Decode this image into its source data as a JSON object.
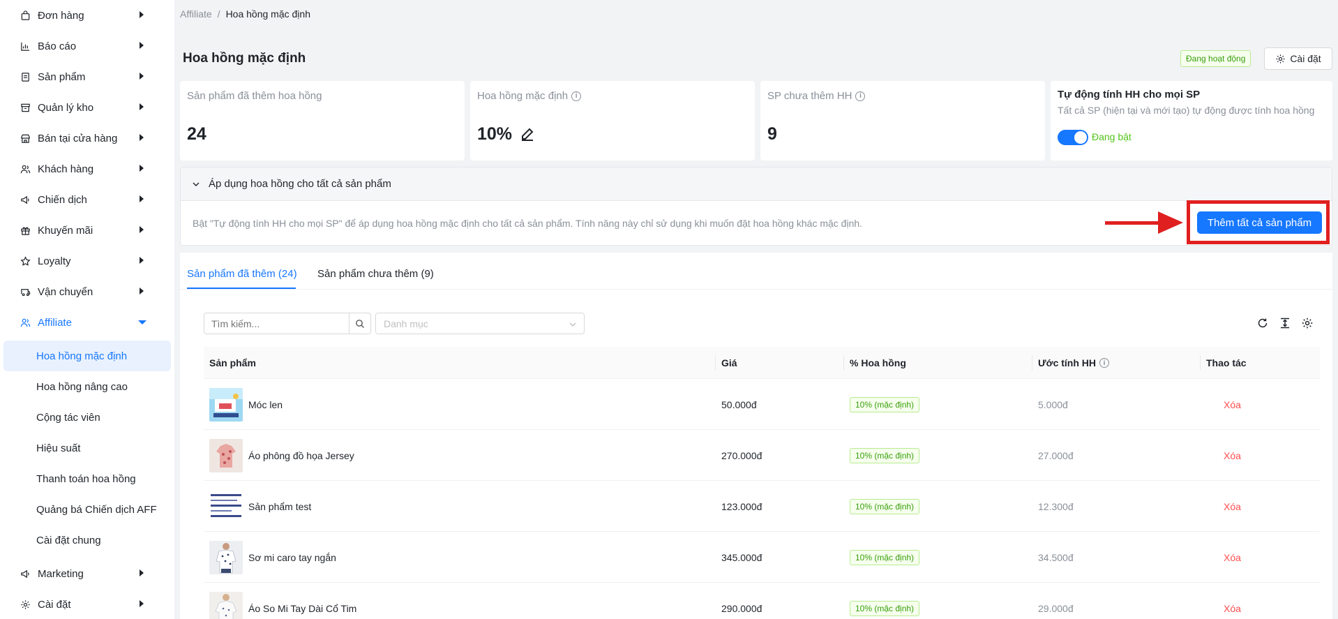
{
  "sidebar": {
    "items": [
      {
        "label": "Đơn hàng",
        "icon": "bag-icon"
      },
      {
        "label": "Báo cáo",
        "icon": "chart-icon"
      },
      {
        "label": "Sản phẩm",
        "icon": "document-icon"
      },
      {
        "label": "Quản lý kho",
        "icon": "archive-icon"
      },
      {
        "label": "Bán tại cửa hàng",
        "icon": "shop-icon"
      },
      {
        "label": "Khách hàng",
        "icon": "users-icon"
      },
      {
        "label": "Chiến dịch",
        "icon": "megaphone-icon"
      },
      {
        "label": "Khuyến mãi",
        "icon": "gift-icon"
      },
      {
        "label": "Loyalty",
        "icon": "star-icon"
      },
      {
        "label": "Vận chuyển",
        "icon": "truck-icon"
      },
      {
        "label": "Affiliate",
        "icon": "affiliate-icon"
      },
      {
        "label": "Marketing",
        "icon": "megaphone-icon"
      },
      {
        "label": "Cài đặt",
        "icon": "gear-icon"
      }
    ],
    "affiliate_sub": [
      "Hoa hồng mặc định",
      "Hoa hồng nâng cao",
      "Cộng tác viên",
      "Hiệu suất",
      "Thanh toán hoa hồng",
      "Quảng bá Chiến dịch AFF",
      "Cài đặt chung"
    ]
  },
  "breadcrumb": {
    "root": "Affiliate",
    "sep": "/",
    "current": "Hoa hồng mặc định"
  },
  "header": {
    "title": "Hoa hồng mặc định",
    "status": "Đang hoạt động",
    "settings_label": "Cài đặt"
  },
  "stats": {
    "added": {
      "label": "Sản phẩm đã thêm hoa hồng",
      "value": "24"
    },
    "default_rate": {
      "label": "Hoa hồng mặc định",
      "value": "10%"
    },
    "not_added": {
      "label": "SP chưa thêm HH",
      "value": "9"
    },
    "auto": {
      "title": "Tự động tính HH cho mọi SP",
      "desc": "Tất cả SP (hiện tại và mới tạo) tự động được tính hoa hồng",
      "toggle_label": "Đang bật",
      "enabled": true
    }
  },
  "apply_panel": {
    "title": "Áp dụng hoa hồng cho tất cả sản phẩm",
    "description": "Bật \"Tự động tính HH cho mọi SP\" để áp dụng hoa hồng mặc định cho tất cả sản phẩm. Tính năng này chỉ sử dụng khi muốn đặt hoa hồng khác mặc định.",
    "button": "Thêm tất cả sản phẩm"
  },
  "tabs": [
    {
      "label": "Sản phẩm đã thêm (24)",
      "active": true
    },
    {
      "label": "Sản phẩm chưa thêm (9)",
      "active": false
    }
  ],
  "filters": {
    "search_placeholder": "Tìm kiếm...",
    "category_placeholder": "Danh mục"
  },
  "table": {
    "columns": [
      "Sản phẩm",
      "Giá",
      "% Hoa hồng",
      "Ước tính HH",
      "Thao tác"
    ],
    "rows": [
      {
        "name": "Móc len",
        "price": "50.000đ",
        "rate": "10% (mặc định)",
        "estimate": "5.000đ",
        "action": "Xóa"
      },
      {
        "name": "Áo phông đồ họa Jersey",
        "price": "270.000đ",
        "rate": "10% (mặc định)",
        "estimate": "27.000đ",
        "action": "Xóa"
      },
      {
        "name": "Sản phẩm test",
        "price": "123.000đ",
        "rate": "10% (mặc định)",
        "estimate": "12.300đ",
        "action": "Xóa"
      },
      {
        "name": "Sơ mi caro tay ngắn",
        "price": "345.000đ",
        "rate": "10% (mặc định)",
        "estimate": "34.500đ",
        "action": "Xóa"
      },
      {
        "name": "Áo So Mi Tay Dài Cổ Tim",
        "price": "290.000đ",
        "rate": "10% (mặc định)",
        "estimate": "29.000đ",
        "action": "Xóa"
      }
    ]
  },
  "colors": {
    "primary": "#1677ff",
    "success": "#52c41a",
    "danger": "#ff4d4f",
    "highlight": "#e02020"
  }
}
